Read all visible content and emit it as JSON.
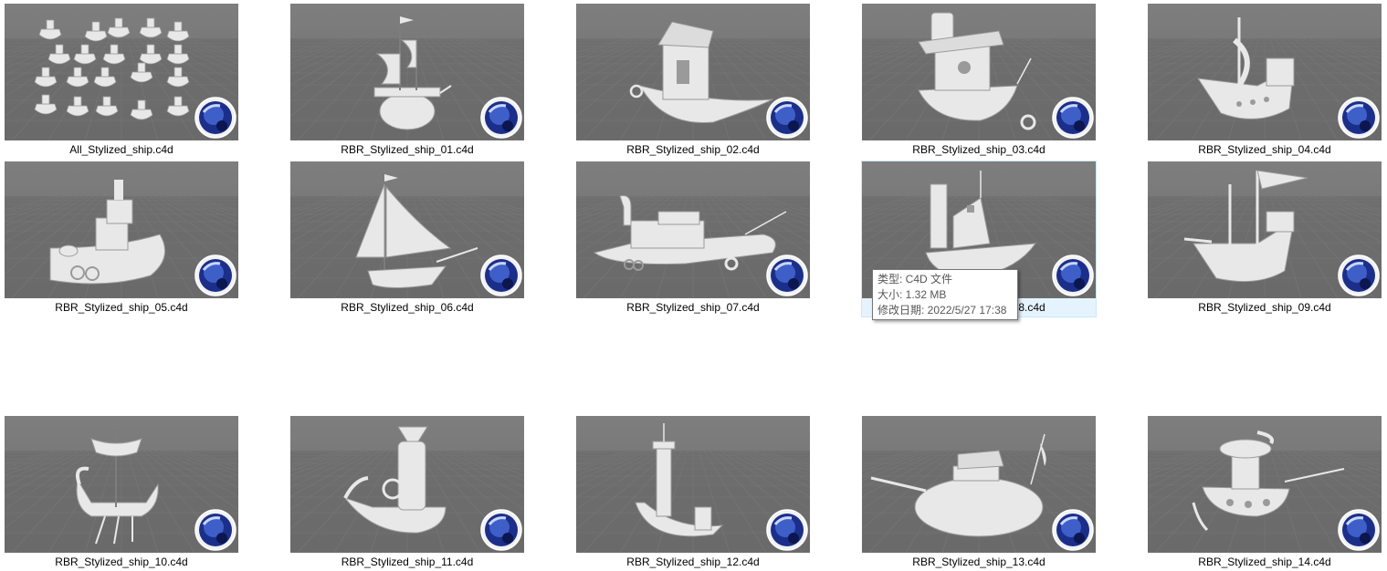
{
  "files": [
    {
      "name": "All_Stylized_ship.c4d",
      "model": "collection",
      "icon": "c4d-file-icon"
    },
    {
      "name": "RBR_Stylized_ship_01.c4d",
      "model": "galleon",
      "icon": "c4d-file-icon"
    },
    {
      "name": "RBR_Stylized_ship_02.c4d",
      "model": "house-boat",
      "icon": "c4d-file-icon"
    },
    {
      "name": "RBR_Stylized_ship_03.c4d",
      "model": "cabin-boat",
      "icon": "c4d-file-icon"
    },
    {
      "name": "RBR_Stylized_ship_04.c4d",
      "model": "pirate-ship",
      "icon": "c4d-file-icon"
    },
    {
      "name": "RBR_Stylized_ship_05.c4d",
      "model": "tugboat",
      "icon": "c4d-file-icon"
    },
    {
      "name": "RBR_Stylized_ship_06.c4d",
      "model": "sailboat",
      "icon": "c4d-file-icon"
    },
    {
      "name": "RBR_Stylized_ship_07.c4d",
      "model": "steamboat",
      "icon": "c4d-file-icon"
    },
    {
      "name": "RBR_Stylized_ship_08.c4d",
      "model": "funnel-boat",
      "icon": "c4d-file-icon"
    },
    {
      "name": "RBR_Stylized_ship_09.c4d",
      "model": "flag-ship",
      "icon": "c4d-file-icon"
    },
    {
      "name": "RBR_Stylized_ship_10.c4d",
      "model": "viking-ship",
      "icon": "c4d-file-icon"
    },
    {
      "name": "RBR_Stylized_ship_11.c4d",
      "model": "whale-boat",
      "icon": "c4d-file-icon"
    },
    {
      "name": "RBR_Stylized_ship_12.c4d",
      "model": "tower-boat",
      "icon": "c4d-file-icon"
    },
    {
      "name": "RBR_Stylized_ship_13.c4d",
      "model": "round-ship",
      "icon": "c4d-file-icon"
    },
    {
      "name": "RBR_Stylized_ship_14.c4d",
      "model": "tower-ship",
      "icon": "c4d-file-icon"
    }
  ],
  "hovered_index": 8,
  "tooltip": {
    "type_line": "类型: C4D 文件",
    "size_line": "大小: 1.32 MB",
    "date_line": "修改日期: 2022/5/27 17:38"
  },
  "colors": {
    "selection_bg": "#e5f3ff",
    "viewport_gray": "#6e6e6e",
    "model_white": "#e6e6e6",
    "logo_blue": "#1b2f8a"
  }
}
